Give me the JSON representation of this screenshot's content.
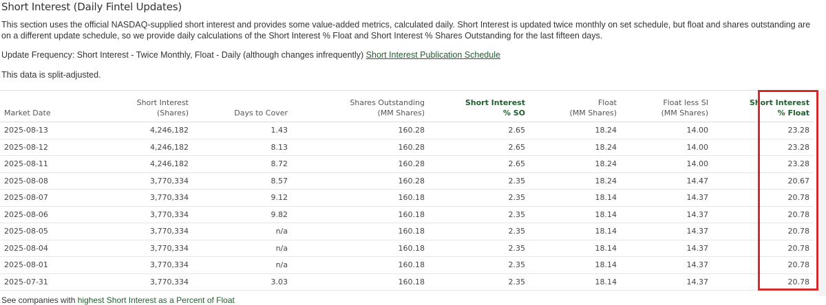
{
  "section": {
    "title": "Short Interest (Daily Fintel Updates)",
    "description": "This section uses the official NASDAQ-supplied short interest and provides some value-added metrics, calculated daily. Short Interest is updated twice monthly on set schedule, but float and shares outstanding are on a different update schedule, so we provide daily calculations of the Short Interest % Float and Short Interest % Shares Outstanding for the last fifteen days.",
    "frequency_text": "Update Frequency: Short Interest - Twice Monthly, Float - Daily (although changes infrequently)",
    "schedule_link": "Short Interest Publication Schedule",
    "split_note": "This data is split-adjusted."
  },
  "table": {
    "headers": [
      {
        "line1": "",
        "line2": "Market Date"
      },
      {
        "line1": "Short Interest",
        "line2": "(Shares)"
      },
      {
        "line1": "",
        "line2": "Days to Cover"
      },
      {
        "line1": "Shares Outstanding",
        "line2": "(MM Shares)"
      },
      {
        "line1": "Short Interest",
        "line2": "% SO"
      },
      {
        "line1": "Float",
        "line2": "(MM Shares)"
      },
      {
        "line1": "Float less SI",
        "line2": "(MM Shares)"
      },
      {
        "line1": "Short Interest",
        "line2": "% Float"
      }
    ],
    "rows": [
      [
        "2025-08-13",
        "4,246,182",
        "1.43",
        "160.28",
        "2.65",
        "18.24",
        "14.00",
        "23.28"
      ],
      [
        "2025-08-12",
        "4,246,182",
        "8.13",
        "160.28",
        "2.65",
        "18.24",
        "14.00",
        "23.28"
      ],
      [
        "2025-08-11",
        "4,246,182",
        "8.72",
        "160.28",
        "2.65",
        "18.24",
        "14.00",
        "23.28"
      ],
      [
        "2025-08-08",
        "3,770,334",
        "8.57",
        "160.28",
        "2.35",
        "18.24",
        "14.47",
        "20.67"
      ],
      [
        "2025-08-07",
        "3,770,334",
        "9.12",
        "160.18",
        "2.35",
        "18.14",
        "14.37",
        "20.78"
      ],
      [
        "2025-08-06",
        "3,770,334",
        "9.82",
        "160.18",
        "2.35",
        "18.14",
        "14.37",
        "20.78"
      ],
      [
        "2025-08-05",
        "3,770,334",
        "n/a",
        "160.18",
        "2.35",
        "18.14",
        "14.37",
        "20.78"
      ],
      [
        "2025-08-04",
        "3,770,334",
        "n/a",
        "160.18",
        "2.35",
        "18.14",
        "14.37",
        "20.78"
      ],
      [
        "2025-08-01",
        "3,770,334",
        "n/a",
        "160.18",
        "2.35",
        "18.14",
        "14.37",
        "20.78"
      ],
      [
        "2025-07-31",
        "3,770,334",
        "3.03",
        "160.18",
        "2.35",
        "18.14",
        "14.37",
        "20.78"
      ]
    ]
  },
  "footer": {
    "prefix": "See companies with",
    "link": "highest Short Interest as a Percent of Float"
  },
  "colors": {
    "link_green": "#1f5e2e",
    "highlight_red": "#d42a2a"
  }
}
